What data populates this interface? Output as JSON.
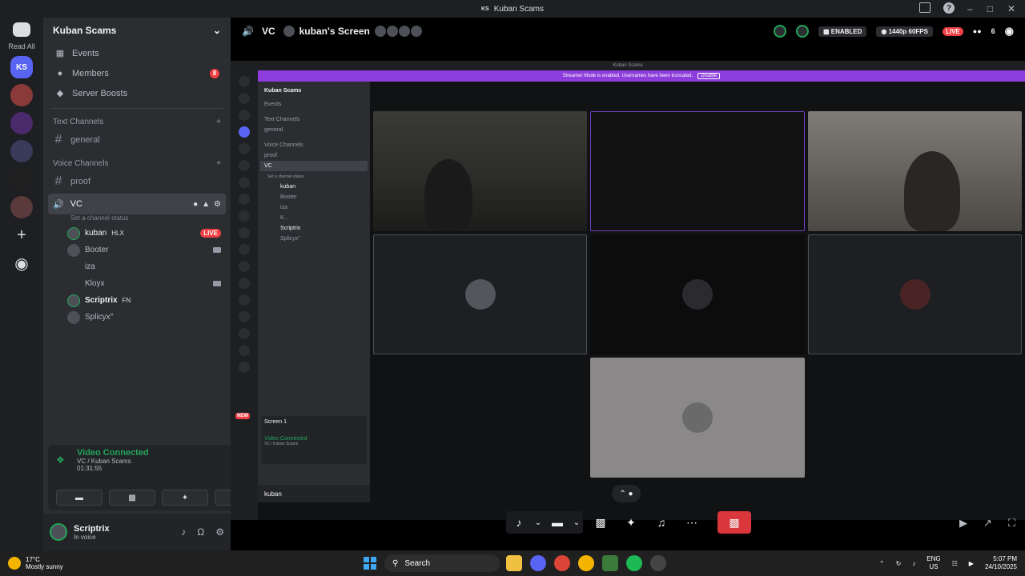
{
  "window": {
    "title": "Kuban Scams",
    "tag": "KS"
  },
  "rail": {
    "read_all": "Read All",
    "active_server": "KS"
  },
  "sidebar": {
    "server_name": "Kuban Scams",
    "nav": [
      {
        "label": "Events"
      },
      {
        "label": "Members",
        "badge": "8"
      },
      {
        "label": "Server Boosts"
      }
    ],
    "text_category": "Text Channels",
    "text_channels": [
      "general"
    ],
    "voice_category": "Voice Channels",
    "voice_text_channels": [
      "proof"
    ],
    "vc": {
      "name": "VC",
      "status_placeholder": "Set a channel status"
    },
    "members": [
      {
        "name": "kuban",
        "tag": "HLX",
        "live": "LIVE"
      },
      {
        "name": "Booter",
        "camera": true
      },
      {
        "name": "iza"
      },
      {
        "name": "Kloyx",
        "camera": true
      },
      {
        "name": "Scriptrix",
        "tag": "FN"
      },
      {
        "name": "Splicyx°"
      }
    ]
  },
  "voice_panel": {
    "status": "Video Connected",
    "location": "VC / Kuban Scams",
    "timer": "01:31:55"
  },
  "user": {
    "name": "Scriptrix",
    "status": "In voice"
  },
  "header": {
    "channel": "VC",
    "screen_title": "kuban's Screen",
    "streamer_mode": "ENABLED",
    "quality": "1440p 60FPS",
    "live": "LIVE",
    "viewer_count": "6"
  },
  "stream": {
    "inner_title": "Kuban Scams",
    "banner": "Streamer Mode is enabled. Usernames have been truncated.",
    "banner_button": "Disable",
    "inner_server": "Kuban Scams",
    "inner_events": "Events",
    "inner_text_cat": "Text Channels",
    "inner_general": "general",
    "inner_voice_cat": "Voice Channels",
    "inner_proof": "proof",
    "inner_vc": "VC",
    "inner_vc_status": "Set a channel status",
    "inner_members": [
      "kuban",
      "Booter",
      "iza",
      "K...",
      "Scriptrix",
      "Splicyx°"
    ],
    "inner_screen": "Screen 1",
    "inner_video_connected": "Video Connected",
    "inner_vc_location": "VC / Kuban Scams",
    "inner_user": "kuban",
    "new_badge": "NEW"
  },
  "taskbar": {
    "temperature": "17°C",
    "weather": "Mostly sunny",
    "search_placeholder": "Search",
    "lang_top": "ENG",
    "lang_bottom": "US",
    "time": "5:07 PM",
    "date": "24/10/2025"
  }
}
